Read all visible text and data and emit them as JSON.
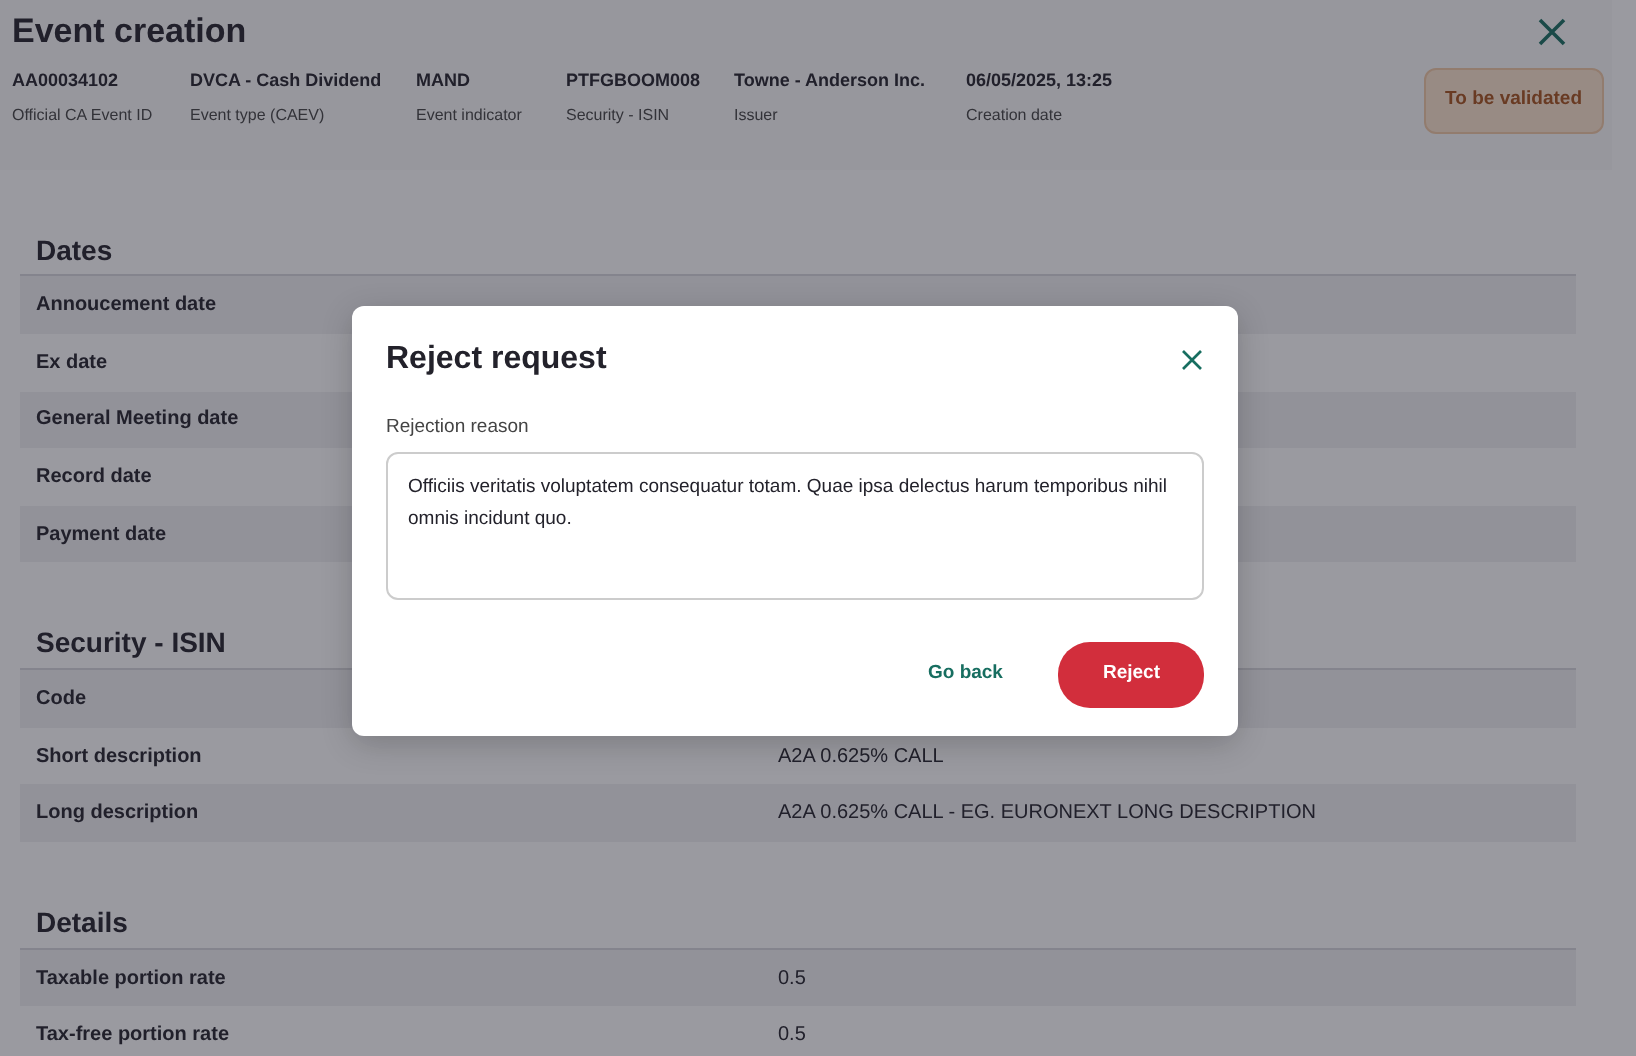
{
  "page": {
    "title": "Event creation",
    "meta": [
      {
        "value": "AA00034102",
        "label": "Official CA Event ID"
      },
      {
        "value": "DVCA - Cash Dividend",
        "label": "Event type (CAEV)"
      },
      {
        "value": "MAND",
        "label": "Event indicator"
      },
      {
        "value": "PTFGBOOM008",
        "label": "Security - ISIN"
      },
      {
        "value": "Towne - Anderson Inc.",
        "label": "Issuer"
      },
      {
        "value": "06/05/2025, 13:25",
        "label": "Creation date"
      }
    ],
    "status": "To be validated",
    "sections": [
      {
        "title": "Dates",
        "rows": [
          {
            "label": "Annoucement date"
          },
          {
            "label": "Ex date"
          },
          {
            "label": "General Meeting date"
          },
          {
            "label": "Record date"
          },
          {
            "label": "Payment date"
          }
        ]
      },
      {
        "title": "Security - ISIN",
        "rows": [
          {
            "label": "Code"
          },
          {
            "label": "Short description",
            "value": "A2A 0.625% CALL"
          },
          {
            "label": "Long description",
            "value": "A2A 0.625% CALL - EG. EURONEXT LONG DESCRIPTION"
          }
        ]
      },
      {
        "title": "Details",
        "rows": [
          {
            "label": "Taxable portion rate",
            "value": "0.5"
          },
          {
            "label": "Tax-free portion rate",
            "value": "0.5"
          }
        ]
      }
    ]
  },
  "dialog": {
    "title": "Reject request",
    "field_label": "Rejection reason",
    "value": "Officiis veritatis voluptatem consequatur totam. Quae ipsa delectus harum temporibus nihil omnis incidunt quo.",
    "buttons": [
      {
        "label": "Go back",
        "kind": "link"
      },
      {
        "label": "Reject",
        "kind": "danger"
      }
    ]
  }
}
